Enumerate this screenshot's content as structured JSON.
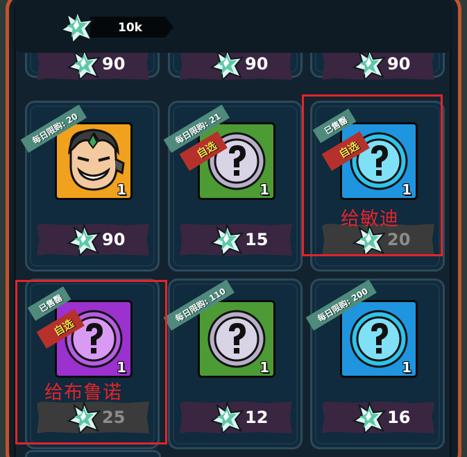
{
  "header": {
    "currency_icon": "crystal-icon",
    "currency_value": "10k"
  },
  "top_row_prices": [
    "90",
    "90",
    "90"
  ],
  "cards": [
    {
      "id": "c1",
      "ribbon": "每日限购: 20",
      "pick": "",
      "item_type": "hero-portrait",
      "item_color": "gold",
      "qty": "1",
      "price": "90",
      "sold": false
    },
    {
      "id": "c2",
      "ribbon": "每日限购: 21",
      "pick": "自选",
      "item_type": "mystery",
      "item_color": "green",
      "qty": "1",
      "price": "15",
      "sold": false
    },
    {
      "id": "c3",
      "ribbon": "已售罄",
      "pick": "自选",
      "item_type": "mystery",
      "item_color": "blue",
      "qty": "1",
      "price": "20",
      "sold": true
    },
    {
      "id": "c4",
      "ribbon": "已售罄",
      "pick": "自选",
      "item_type": "mystery",
      "item_color": "purple",
      "qty": "1",
      "price": "25",
      "sold": true
    },
    {
      "id": "c5",
      "ribbon": "每日限购: 110",
      "pick": "",
      "item_type": "mystery",
      "item_color": "green",
      "qty": "1",
      "price": "12",
      "sold": false
    },
    {
      "id": "c6",
      "ribbon": "每日限购: 200",
      "pick": "",
      "item_type": "mystery",
      "item_color": "blue",
      "qty": "1",
      "price": "16",
      "sold": false
    }
  ],
  "annotations": [
    "给敏迪",
    "给布鲁诺"
  ],
  "colors": {
    "frame": "#c2542b",
    "annotation": "#e3242b",
    "ribbon": "#4f8a7c",
    "pick": "#b6312c"
  }
}
